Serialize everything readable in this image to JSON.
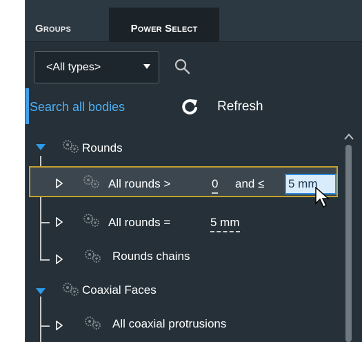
{
  "tabs": [
    {
      "label": "Groups",
      "active": false
    },
    {
      "label": "Power Select",
      "active": true
    }
  ],
  "filter": {
    "selected": "<All types>",
    "search_icon": "search-icon"
  },
  "search_all_label": "Search all bodies",
  "refresh_label": "Refresh",
  "tree": {
    "groups": [
      {
        "label": "Rounds",
        "expanded": true,
        "items": [
          {
            "label_prefix": "All rounds >",
            "min_value": "0",
            "label_mid": "and ≤",
            "max_value": "5 mm",
            "highlighted": true
          },
          {
            "label_prefix": "All rounds =",
            "value": "5 mm"
          },
          {
            "label": "Rounds chains"
          }
        ]
      },
      {
        "label": "Coaxial Faces",
        "expanded": true,
        "items": [
          {
            "label": "All coaxial protrusions"
          }
        ]
      }
    ]
  },
  "colors": {
    "accent": "#3ea1ec",
    "highlight_border": "#c2a12e",
    "panel_bg": "#253038"
  }
}
